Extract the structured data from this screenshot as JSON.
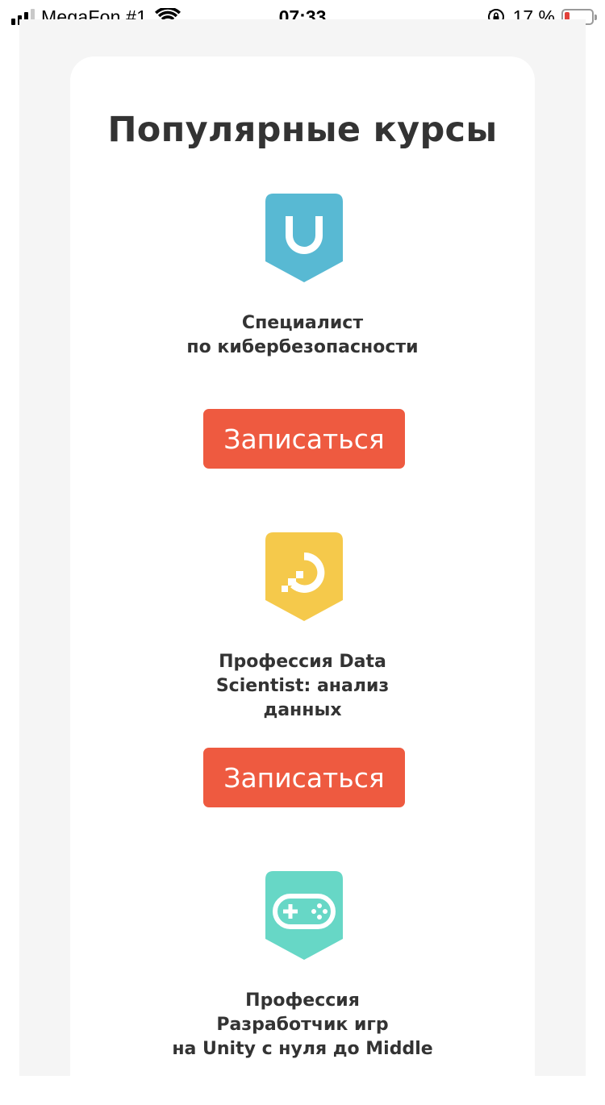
{
  "status_bar": {
    "carrier": "MegaFon #1",
    "time": "07:33",
    "battery_percent": "17 %",
    "battery_level": 0.17,
    "signal_bars_active": 3,
    "signal_bars_total": 4
  },
  "section": {
    "title": "Популярные курсы"
  },
  "courses": [
    {
      "name_lines": [
        "Специалист",
        "по кибербезопасности"
      ],
      "button_label": "Записаться",
      "icon": "shield-u-icon",
      "color": "#58b9d3"
    },
    {
      "name_lines": [
        "Профессия Data",
        "Scientist: анализ",
        "данных"
      ],
      "button_label": "Записаться",
      "icon": "data-ring-icon",
      "color": "#f5c94b"
    },
    {
      "name_lines": [
        "Профессия",
        "Разработчик игр",
        "на Unity с нуля до Middle"
      ],
      "button_label": "",
      "icon": "gamepad-icon",
      "color": "#67d7c6"
    }
  ],
  "colors": {
    "accent_button": "#ee5a40",
    "page_background": "#f5f5f5",
    "card_background": "#ffffff",
    "text": "#333333"
  }
}
